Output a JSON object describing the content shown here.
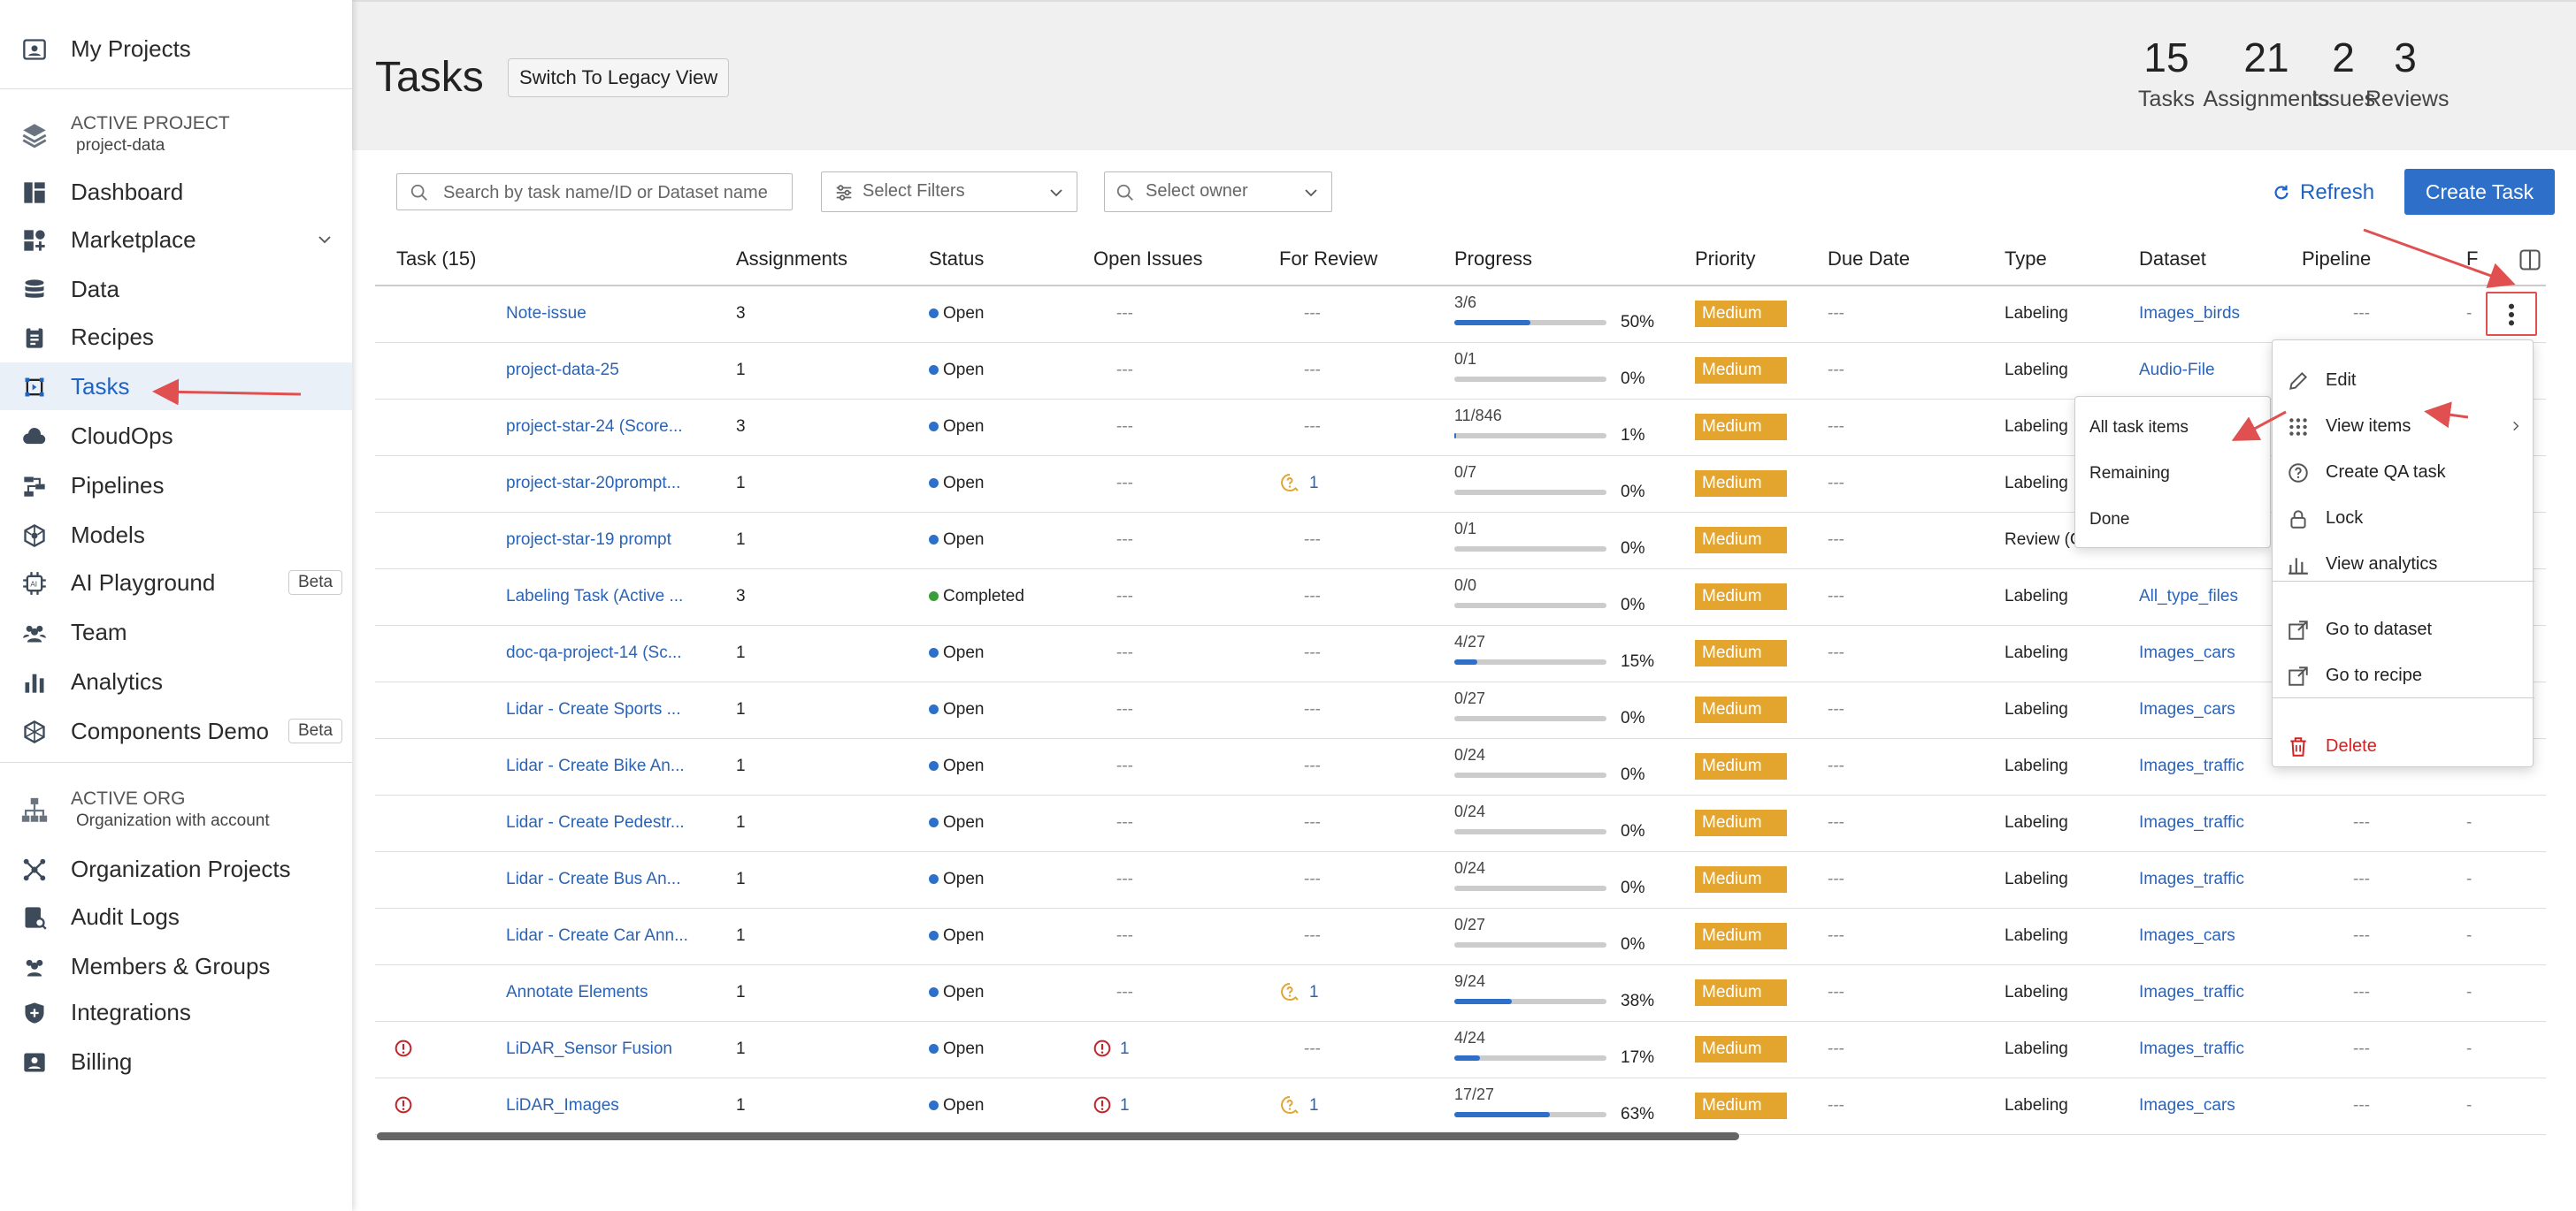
{
  "sidebar": {
    "my_projects": "My Projects",
    "active_project_caption": "ACTIVE PROJECT",
    "active_project_name": "project-data",
    "items": [
      {
        "label": "Dashboard",
        "icon": "dashboard-icon"
      },
      {
        "label": "Marketplace",
        "icon": "marketplace-icon"
      },
      {
        "label": "Data",
        "icon": "data-icon"
      },
      {
        "label": "Recipes",
        "icon": "recipes-icon"
      },
      {
        "label": "Tasks",
        "icon": "tasks-icon"
      },
      {
        "label": "CloudOps",
        "icon": "cloud-icon"
      },
      {
        "label": "Pipelines",
        "icon": "pipelines-icon"
      },
      {
        "label": "Models",
        "icon": "models-icon"
      },
      {
        "label": "AI Playground",
        "icon": "ai-playground-icon"
      },
      {
        "label": "Team",
        "icon": "team-icon"
      },
      {
        "label": "Analytics",
        "icon": "analytics-icon"
      },
      {
        "label": "Components Demo",
        "icon": "components-icon"
      }
    ],
    "beta": "Beta",
    "active_org_caption": "ACTIVE ORG",
    "active_org_name": "Organization with account",
    "org_items": [
      {
        "label": "Organization Projects",
        "icon": "org-projects-icon"
      },
      {
        "label": "Audit Logs",
        "icon": "audit-logs-icon"
      },
      {
        "label": "Members & Groups",
        "icon": "members-icon"
      },
      {
        "label": "Integrations",
        "icon": "integrations-icon"
      },
      {
        "label": "Billing",
        "icon": "billing-icon"
      }
    ]
  },
  "header": {
    "title": "Tasks",
    "legacy_button": "Switch To Legacy View",
    "stats": [
      {
        "num": "15",
        "label": "Tasks"
      },
      {
        "num": "21",
        "label": "Assignments"
      },
      {
        "num": "2",
        "label": "Issues"
      },
      {
        "num": "3",
        "label": "Reviews"
      }
    ]
  },
  "toolbar": {
    "search_placeholder": "Search by task name/ID or Dataset name",
    "filters_placeholder": "Select Filters",
    "owner_placeholder": "Select owner",
    "refresh": "Refresh",
    "create": "Create Task"
  },
  "table": {
    "columns": [
      "Task (15)",
      "Assignments",
      "Status",
      "Open Issues",
      "For Review",
      "Progress",
      "Priority",
      "Due Date",
      "Type",
      "Dataset",
      "Pipeline",
      "F"
    ],
    "rows": [
      {
        "name": "Note-issue",
        "assign": "3",
        "status": "Open",
        "issues": "---",
        "review": "---",
        "frac": "3/6",
        "pct": "50%",
        "p": 0.5,
        "prio": "Medium",
        "due": "---",
        "type": "Labeling",
        "dataset": "Images_birds",
        "pipeline": "---",
        "f": "-",
        "err": false
      },
      {
        "name": "project-data-25",
        "assign": "1",
        "status": "Open",
        "issues": "---",
        "review": "---",
        "frac": "0/1",
        "pct": "0%",
        "p": 0,
        "prio": "Medium",
        "due": "---",
        "type": "Labeling",
        "dataset": "Audio-File",
        "pipeline": "",
        "f": "",
        "err": false
      },
      {
        "name": "project-star-24 (Score...",
        "assign": "3",
        "status": "Open",
        "issues": "---",
        "review": "---",
        "frac": "11/846",
        "pct": "1%",
        "p": 0.01,
        "prio": "Medium",
        "due": "---",
        "type": "Labeling",
        "dataset": "",
        "pipeline": "",
        "f": "",
        "err": false
      },
      {
        "name": "project-star-20prompt...",
        "assign": "1",
        "status": "Open",
        "issues": "---",
        "review": "1",
        "frac": "0/7",
        "pct": "0%",
        "p": 0,
        "prio": "Medium",
        "due": "---",
        "type": "Labeling",
        "dataset": "",
        "pipeline": "",
        "f": "",
        "err": false
      },
      {
        "name": "project-star-19 prompt",
        "assign": "1",
        "status": "Open",
        "issues": "---",
        "review": "---",
        "frac": "0/1",
        "pct": "0%",
        "p": 0,
        "prio": "Medium",
        "due": "---",
        "type": "Review (C",
        "dataset": "",
        "pipeline": "",
        "f": "",
        "err": false
      },
      {
        "name": "Labeling Task (Active ...",
        "assign": "3",
        "status": "Completed",
        "issues": "---",
        "review": "---",
        "frac": "0/0",
        "pct": "0%",
        "p": 0,
        "prio": "Medium",
        "due": "---",
        "type": "Labeling",
        "dataset": "All_type_files",
        "pipeline": "",
        "f": "",
        "err": false
      },
      {
        "name": "doc-qa-project-14 (Sc...",
        "assign": "1",
        "status": "Open",
        "issues": "---",
        "review": "---",
        "frac": "4/27",
        "pct": "15%",
        "p": 0.15,
        "prio": "Medium",
        "due": "---",
        "type": "Labeling",
        "dataset": "Images_cars",
        "pipeline": "",
        "f": "",
        "err": false
      },
      {
        "name": "Lidar - Create Sports ...",
        "assign": "1",
        "status": "Open",
        "issues": "---",
        "review": "---",
        "frac": "0/27",
        "pct": "0%",
        "p": 0,
        "prio": "Medium",
        "due": "---",
        "type": "Labeling",
        "dataset": "Images_cars",
        "pipeline": "",
        "f": "",
        "err": false
      },
      {
        "name": "Lidar - Create Bike An...",
        "assign": "1",
        "status": "Open",
        "issues": "---",
        "review": "---",
        "frac": "0/24",
        "pct": "0%",
        "p": 0,
        "prio": "Medium",
        "due": "---",
        "type": "Labeling",
        "dataset": "Images_traffic",
        "pipeline": "",
        "f": "",
        "err": false
      },
      {
        "name": "Lidar - Create Pedestr...",
        "assign": "1",
        "status": "Open",
        "issues": "---",
        "review": "---",
        "frac": "0/24",
        "pct": "0%",
        "p": 0,
        "prio": "Medium",
        "due": "---",
        "type": "Labeling",
        "dataset": "Images_traffic",
        "pipeline": "---",
        "f": "-",
        "err": false
      },
      {
        "name": "Lidar - Create Bus An...",
        "assign": "1",
        "status": "Open",
        "issues": "---",
        "review": "---",
        "frac": "0/24",
        "pct": "0%",
        "p": 0,
        "prio": "Medium",
        "due": "---",
        "type": "Labeling",
        "dataset": "Images_traffic",
        "pipeline": "---",
        "f": "-",
        "err": false
      },
      {
        "name": "Lidar - Create Car Ann...",
        "assign": "1",
        "status": "Open",
        "issues": "---",
        "review": "---",
        "frac": "0/27",
        "pct": "0%",
        "p": 0,
        "prio": "Medium",
        "due": "---",
        "type": "Labeling",
        "dataset": "Images_cars",
        "pipeline": "---",
        "f": "-",
        "err": false
      },
      {
        "name": "Annotate Elements",
        "assign": "1",
        "status": "Open",
        "issues": "---",
        "review": "1",
        "frac": "9/24",
        "pct": "38%",
        "p": 0.38,
        "prio": "Medium",
        "due": "---",
        "type": "Labeling",
        "dataset": "Images_traffic",
        "pipeline": "---",
        "f": "-",
        "err": false
      },
      {
        "name": "LiDAR_Sensor Fusion",
        "assign": "1",
        "status": "Open",
        "issues": "1",
        "review": "---",
        "frac": "4/24",
        "pct": "17%",
        "p": 0.17,
        "prio": "Medium",
        "due": "---",
        "type": "Labeling",
        "dataset": "Images_traffic",
        "pipeline": "---",
        "f": "-",
        "err": true
      },
      {
        "name": "LiDAR_Images",
        "assign": "1",
        "status": "Open",
        "issues": "1",
        "review": "1",
        "frac": "17/27",
        "pct": "63%",
        "p": 0.63,
        "prio": "Medium",
        "due": "---",
        "type": "Labeling",
        "dataset": "Images_cars",
        "pipeline": "---",
        "f": "-",
        "err": true
      }
    ]
  },
  "context_menu": {
    "items": [
      {
        "label": "Edit",
        "icon": "edit-icon"
      },
      {
        "label": "View items",
        "icon": "grid-icon"
      },
      {
        "label": "Create QA task",
        "icon": "qa-icon"
      },
      {
        "label": "Lock",
        "icon": "lock-icon"
      },
      {
        "label": "View analytics",
        "icon": "analytics-icon"
      },
      {
        "label": "Go to dataset",
        "icon": "external-link-icon"
      },
      {
        "label": "Go to recipe",
        "icon": "external-link-icon"
      },
      {
        "label": "Delete",
        "icon": "trash-icon"
      }
    ],
    "submenu": [
      "All task items",
      "Remaining",
      "Done"
    ]
  },
  "colors": {
    "accent": "#2e6fc9",
    "priority": "#e3a52e",
    "danger": "#d32020",
    "annotation": "#e05050"
  }
}
